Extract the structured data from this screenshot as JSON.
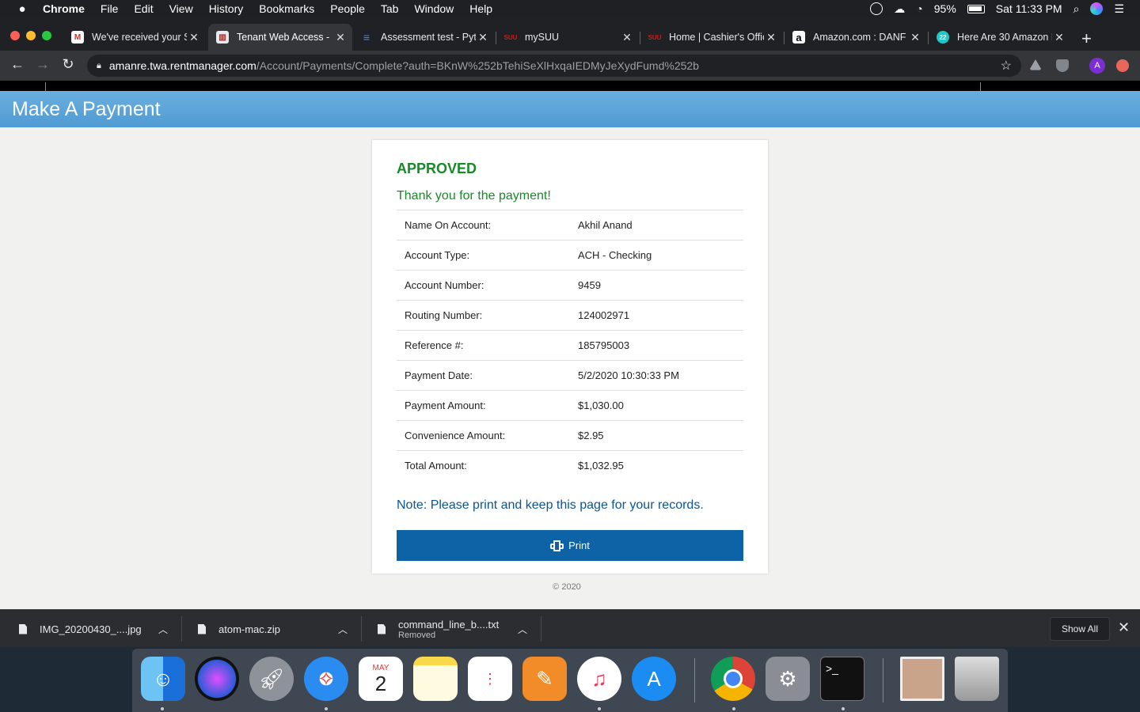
{
  "menubar": {
    "app": "Chrome",
    "items": [
      "File",
      "Edit",
      "View",
      "History",
      "Bookmarks",
      "People",
      "Tab",
      "Window",
      "Help"
    ],
    "battery": "95%",
    "clock": "Sat 11:33 PM"
  },
  "tabs": [
    {
      "title": "We've received your S",
      "favicon": "gmail-icon",
      "color": "#d93025",
      "active": false
    },
    {
      "title": "Tenant Web Access - ",
      "favicon": "building-icon",
      "color": "#b3261e",
      "active": true
    },
    {
      "title": "Assessment test - Pyt",
      "favicon": "lines-icon",
      "color": "#4285f4",
      "active": false
    },
    {
      "title": "mySUU",
      "favicon": "suu-icon",
      "color": "#b3261e",
      "active": false
    },
    {
      "title": "Home | Cashier's Offic",
      "favicon": "suu-icon",
      "color": "#b3261e",
      "active": false
    },
    {
      "title": "Amazon.com : DANF",
      "favicon": "amazon-icon",
      "color": "#ffffff",
      "active": false
    },
    {
      "title": "Here Are 30 Amazon P",
      "favicon": "badge-22-icon",
      "color": "#1ec8c8",
      "active": false
    }
  ],
  "toolbar": {
    "url_host": "amanre.twa.rentmanager.com",
    "url_path": "/Account/Payments/Complete?auth=BKnW%252bTehiSeXlHxqaIEDMyJeXydFumd%252b",
    "profile_initial": "A"
  },
  "page": {
    "header_title": "Make A Payment",
    "status": "APPROVED",
    "thanks": "Thank you for the payment!",
    "rows": [
      {
        "label": "Name On Account:",
        "value": "Akhil Anand"
      },
      {
        "label": "Account Type:",
        "value": "ACH - Checking"
      },
      {
        "label": "Account Number:",
        "value": "9459"
      },
      {
        "label": "Routing Number:",
        "value": "124002971"
      },
      {
        "label": "Reference #:",
        "value": "185795003"
      },
      {
        "label": "Payment Date:",
        "value": "5/2/2020 10:30:33 PM"
      },
      {
        "label": "Payment Amount:",
        "value": "$1,030.00"
      },
      {
        "label": "Convenience Amount:",
        "value": "$2.95"
      },
      {
        "label": "Total Amount:",
        "value": "$1,032.95"
      }
    ],
    "note": "Note: Please print and keep this page for your records.",
    "print_label": "Print",
    "copyright": "© 2020"
  },
  "downloads": {
    "items": [
      {
        "name": "IMG_20200430_....jpg",
        "sub": ""
      },
      {
        "name": "atom-mac.zip",
        "sub": ""
      },
      {
        "name": "command_line_b....txt",
        "sub": "Removed"
      }
    ],
    "show_all": "Show All"
  },
  "dock": {
    "calendar_month": "MAY",
    "calendar_day": "2",
    "icons": [
      "finder-icon",
      "siri-icon",
      "launchpad-icon",
      "safari-icon",
      "calendar-icon",
      "notes-icon",
      "reminders-icon",
      "pages-icon",
      "music-icon",
      "app-store-icon",
      "chrome-icon",
      "system-preferences-icon",
      "terminal-icon",
      "photo-stack-icon",
      "trash-icon"
    ]
  },
  "colors": {
    "approved_green": "#178a28",
    "header_blue": "#5aa3d8",
    "print_button": "#0e63a6",
    "note_blue": "#0d5591"
  }
}
